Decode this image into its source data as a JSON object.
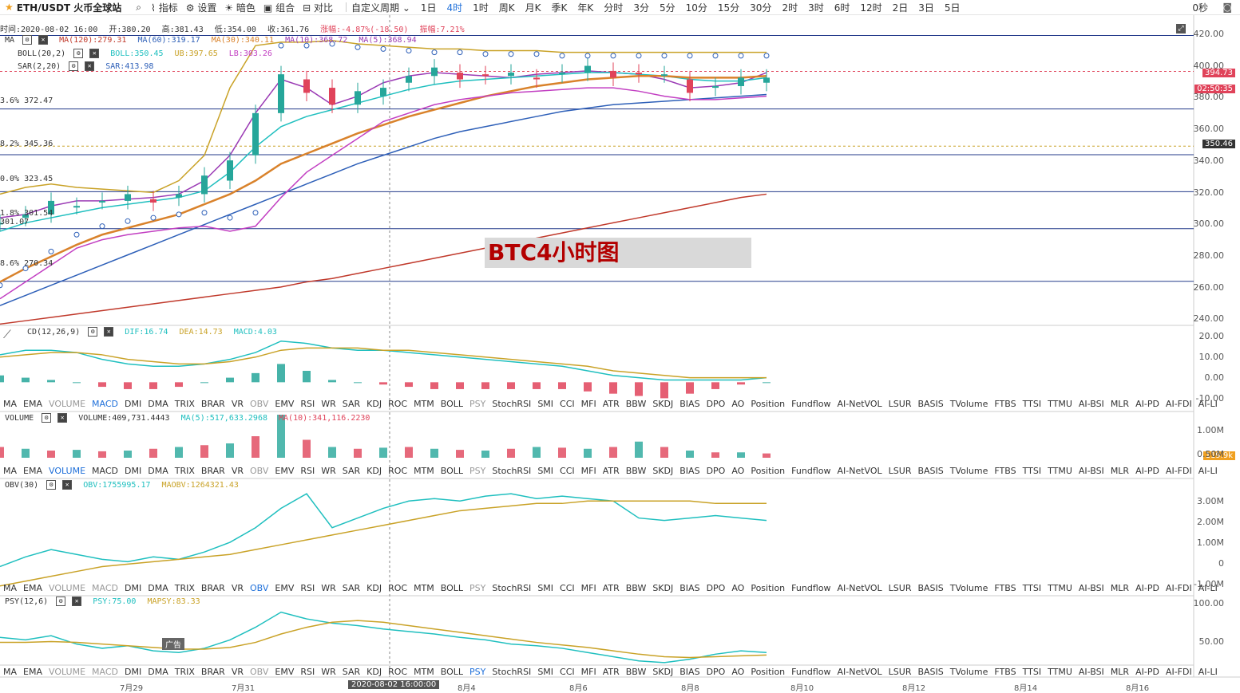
{
  "topbar": {
    "pair": "ETH/USDT 火币全球站",
    "tools": [
      "指标",
      "设置",
      "暗色",
      "组合",
      "对比"
    ],
    "custom_period": "自定义周期",
    "periods": [
      "1日",
      "4时",
      "1时",
      "周K",
      "月K",
      "季K",
      "年K",
      "分时",
      "3分",
      "5分",
      "10分",
      "15分",
      "30分",
      "2时",
      "3时",
      "6时",
      "12时",
      "2日",
      "3日",
      "5日"
    ],
    "active_period": "4时",
    "countdown": "0秒"
  },
  "ohlc": {
    "time": "时间:2020-08-02 16:00",
    "open": "开:380.20",
    "high": "高:381.43",
    "low": "低:354.00",
    "close": "收:361.76",
    "change": "涨幅:-4.87%(-18.50)",
    "amplitude": "振幅:7.21%"
  },
  "ma_legend": {
    "name": "MA",
    "ma120": "MA(120):279.31",
    "ma60": "MA(60):319.17",
    "ma30": "MA(30):340.11",
    "ma10": "MA(10):368.72",
    "ma5": "MA(5):368.94"
  },
  "boll_legend": {
    "name": "BOLL(20,2)",
    "boll": "BOLL:350.45",
    "ub": "UB:397.65",
    "lb": "LB:303.26"
  },
  "sar_legend": {
    "name": "SAR(2,20)",
    "sar": "SAR:413.98"
  },
  "macd_legend": {
    "name": "CD(12,26,9)",
    "dif": "DIF:16.74",
    "dea": "DEA:14.73",
    "macd": "MACD:4.03"
  },
  "vol_legend": {
    "name": "VOLUME",
    "vol": "VOLUME:409,731.4443",
    "ma5": "MA(5):517,633.2968",
    "ma10": "MA(10):341,116.2230"
  },
  "obv_legend": {
    "name": "OBV(30)",
    "obv": "OBV:1755995.17",
    "maobv": "MAOBV:1264321.43"
  },
  "psy_legend": {
    "name": "PSY(12,6)",
    "psy": "PSY:75.00",
    "mapsy": "MAPSY:83.33"
  },
  "fib_labels": [
    "3.6% 372.47",
    "8.2% 345.36",
    "0.0% 323.45",
    "1.8% 301.54",
    "8.6% 270.34"
  ],
  "fib_partial": "301.07",
  "price_tags": {
    "last": "394.73",
    "countdown": "02:50:35",
    "line": "350.46",
    "vol_tag": "119.9k"
  },
  "watermark": "BTC4小时图",
  "ad_label": "广告",
  "indicator_tabs": [
    "MA",
    "EMA",
    "VOLUME",
    "MACD",
    "DMI",
    "DMA",
    "TRIX",
    "BRAR",
    "VR",
    "OBV",
    "EMV",
    "RSI",
    "WR",
    "SAR",
    "KDJ",
    "ROC",
    "MTM",
    "BOLL",
    "PSY",
    "StochRSI",
    "SMI",
    "CCI",
    "MFI",
    "ATR",
    "BBW",
    "SKDJ",
    "BIAS",
    "DPO",
    "AO",
    "Position",
    "Fundflow",
    "AI-NetVOL",
    "LSUR",
    "BASIS",
    "TVolume",
    "FTBS",
    "TTSI",
    "TTMU",
    "AI-BSI",
    "MLR",
    "AI-PD",
    "AI-FDI",
    "AI-LI"
  ],
  "tab_rows": [
    {
      "active": "MACD",
      "dim": [
        "VOLUME",
        "OBV",
        "PSY"
      ]
    },
    {
      "active": "VOLUME",
      "dim": [
        "OBV",
        "PSY"
      ]
    },
    {
      "active": "OBV",
      "dim": [
        "VOLUME",
        "MACD",
        "PSY"
      ]
    },
    {
      "active": "PSY",
      "dim": [
        "VOLUME",
        "MACD",
        "OBV"
      ]
    }
  ],
  "price_axis": [
    "420.00",
    "400.00",
    "380.00",
    "360.00",
    "340.00",
    "320.00",
    "300.00",
    "280.00",
    "260.00",
    "240.00"
  ],
  "macd_axis": [
    "20.00",
    "10.00",
    "0.00",
    "-10.00"
  ],
  "vol_axis": [
    "1.00M",
    "0.50M"
  ],
  "obv_axis": [
    "3.00M",
    "2.00M",
    "1.00M",
    "0",
    "-1.00M"
  ],
  "psy_axis": [
    "100.00",
    "50.00"
  ],
  "x_labels": [
    "7月29",
    "7月31",
    "8月4",
    "8月6",
    "8月8",
    "8月10",
    "8月12",
    "8月14",
    "8月16"
  ],
  "crosshair_label": "2020-08-02 16:00:00",
  "colors": {
    "up": "#26a69a",
    "down": "#e0435a",
    "ma5": "#9b3bb5",
    "ma10": "#1fbfbf",
    "ma30": "#d9822b",
    "ma60": "#2d5fb8",
    "ma120": "#c0392b",
    "ub": "#c9a227",
    "lb": "#c23fc2",
    "active": "#1e6fd9"
  },
  "chart_data": [
    {
      "type": "line",
      "title": "",
      "ylabel": "",
      "ylim": [
        240,
        420
      ],
      "series": [
        {
          "name": "MA(5)",
          "values": [
            308,
            310,
            315,
            318,
            318,
            319,
            320,
            322,
            330,
            345,
            370,
            390,
            385,
            375,
            380,
            388,
            392,
            394,
            393,
            392,
            391,
            393,
            394,
            395,
            394,
            393,
            390,
            385,
            386,
            388,
            394
          ]
        },
        {
          "name": "MA(10)",
          "values": [
            300,
            305,
            308,
            311,
            314,
            316,
            318,
            320,
            324,
            335,
            350,
            362,
            368,
            372,
            376,
            380,
            384,
            387,
            389,
            390,
            391,
            392,
            393,
            394,
            394,
            393,
            392,
            390,
            389,
            389,
            391
          ]
        },
        {
          "name": "MA(30)",
          "values": [
            270,
            278,
            285,
            292,
            298,
            302,
            306,
            310,
            316,
            322,
            330,
            340,
            346,
            352,
            358,
            363,
            368,
            372,
            376,
            380,
            383,
            386,
            388,
            390,
            391,
            392,
            392,
            391,
            391,
            391,
            392
          ]
        },
        {
          "name": "MA(60)",
          "values": [
            256,
            262,
            268,
            274,
            280,
            286,
            292,
            298,
            304,
            310,
            316,
            322,
            328,
            334,
            340,
            345,
            350,
            355,
            359,
            362,
            365,
            368,
            371,
            373,
            375,
            376,
            377,
            378,
            379,
            380,
            381
          ]
        },
        {
          "name": "MA(120)",
          "values": [
            245,
            247,
            249,
            251,
            253,
            255,
            257,
            259,
            261,
            263,
            265,
            267,
            270,
            272,
            275,
            278,
            281,
            284,
            287,
            290,
            293,
            296,
            299,
            302,
            305,
            308,
            311,
            314,
            317,
            320,
            322
          ]
        },
        {
          "name": "UB",
          "values": [
            322,
            326,
            328,
            326,
            325,
            324,
            323,
            330,
            345,
            385,
            410,
            412,
            412,
            413,
            411,
            410,
            409,
            408,
            408,
            407,
            407,
            407,
            406,
            406,
            406,
            406,
            406,
            406,
            406,
            406,
            406
          ]
        },
        {
          "name": "LB",
          "values": [
            260,
            270,
            280,
            290,
            295,
            298,
            300,
            302,
            303,
            300,
            303,
            320,
            335,
            345,
            355,
            365,
            370,
            375,
            378,
            380,
            382,
            383,
            384,
            385,
            385,
            383,
            380,
            378,
            378,
            379,
            380
          ]
        }
      ]
    },
    {
      "type": "bar",
      "title": "",
      "ylim": [
        -10,
        20
      ],
      "series": [
        {
          "name": "DIF",
          "values": [
            12,
            14,
            14,
            13,
            10,
            8,
            7,
            7,
            8,
            10,
            13,
            18,
            17,
            15,
            14,
            14,
            13,
            12,
            11,
            10,
            9,
            8,
            7,
            5,
            3,
            2,
            1,
            1,
            1,
            1,
            2
          ]
        },
        {
          "name": "DEA",
          "values": [
            11,
            12,
            13,
            13,
            12,
            10,
            9,
            8,
            8,
            9,
            11,
            14,
            15,
            15,
            15,
            14,
            14,
            13,
            12,
            11,
            10,
            9,
            8,
            7,
            5,
            4,
            3,
            2,
            2,
            2,
            2
          ]
        },
        {
          "name": "MACD",
          "values": [
            3,
            2,
            1,
            0,
            -2,
            -3,
            -3,
            -2,
            0,
            2,
            4,
            8,
            5,
            1,
            0,
            -1,
            -2,
            -3,
            -3,
            -3,
            -3,
            -3,
            -3,
            -4,
            -5,
            -6,
            -7,
            -5,
            -3,
            -1,
            0
          ]
        }
      ]
    },
    {
      "type": "bar",
      "title": "",
      "series": [
        {
          "name": "VOLUME",
          "values": [
            0.3,
            0.25,
            0.2,
            0.22,
            0.18,
            0.2,
            0.25,
            0.3,
            0.35,
            0.4,
            0.6,
            1.2,
            0.5,
            0.3,
            0.25,
            0.28,
            0.3,
            0.25,
            0.22,
            0.2,
            0.25,
            0.3,
            0.28,
            0.25,
            0.3,
            0.45,
            0.3,
            0.2,
            0.15,
            0.15,
            0.12
          ]
        }
      ]
    },
    {
      "type": "line",
      "title": "",
      "ylim": [
        -1000000,
        3500000
      ],
      "series": [
        {
          "name": "OBV",
          "values": [
            200000,
            600000,
            900000,
            700000,
            500000,
            400000,
            600000,
            500000,
            800000,
            1200000,
            1800000,
            2600000,
            3200000,
            1800000,
            2200000,
            2600000,
            2900000,
            3000000,
            2900000,
            3100000,
            3200000,
            3000000,
            3100000,
            3000000,
            2900000,
            2200000,
            2100000,
            2200000,
            2300000,
            2200000,
            2100000
          ]
        },
        {
          "name": "MAOBV",
          "values": [
            -600000,
            -400000,
            -200000,
            0,
            200000,
            300000,
            400000,
            500000,
            600000,
            700000,
            900000,
            1100000,
            1300000,
            1500000,
            1700000,
            1900000,
            2100000,
            2300000,
            2500000,
            2600000,
            2700000,
            2800000,
            2800000,
            2900000,
            2900000,
            2900000,
            2900000,
            2900000,
            2800000,
            2800000,
            2800000
          ]
        }
      ]
    },
    {
      "type": "line",
      "title": "",
      "ylim": [
        25,
        100
      ],
      "series": [
        {
          "name": "PSY",
          "values": [
            58,
            55,
            60,
            50,
            45,
            48,
            42,
            40,
            45,
            55,
            70,
            88,
            80,
            75,
            72,
            68,
            65,
            62,
            58,
            55,
            50,
            48,
            45,
            40,
            35,
            30,
            28,
            32,
            38,
            42,
            40
          ]
        },
        {
          "name": "MAPSY",
          "values": [
            52,
            52,
            53,
            52,
            50,
            48,
            46,
            44,
            44,
            46,
            52,
            62,
            70,
            76,
            78,
            76,
            72,
            68,
            64,
            60,
            56,
            52,
            49,
            46,
            42,
            38,
            35,
            34,
            35,
            36,
            37
          ]
        }
      ]
    }
  ]
}
